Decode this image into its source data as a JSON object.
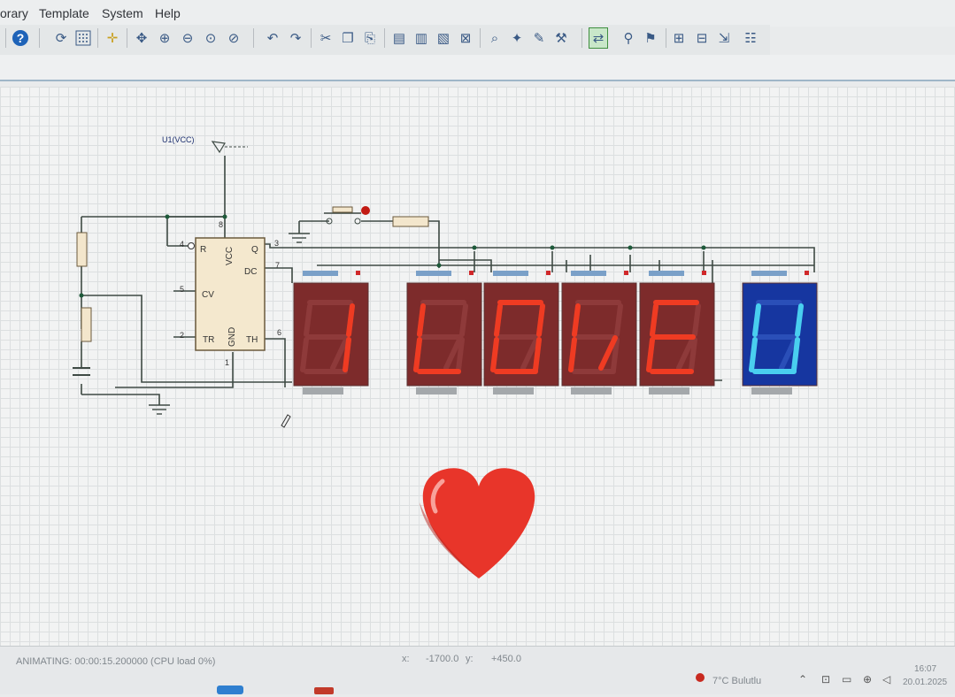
{
  "menu": [
    "orary",
    "Template",
    "System",
    "Help"
  ],
  "toolbar": {
    "icons": [
      "help-icon",
      "refresh-icon",
      "grid-toggle-icon",
      "origin-icon",
      "pan-icon",
      "zoom-in-icon",
      "zoom-out-icon",
      "zoom-all-icon",
      "zoom-area-icon",
      "undo-icon",
      "redo-icon",
      "cut-icon",
      "copy-icon",
      "paste-icon",
      "block-copy-icon",
      "block-move-icon",
      "block-rotate-icon",
      "block-delete-icon",
      "pick-device-icon",
      "make-device-icon",
      "packaging-tool-icon",
      "decompose-icon",
      "wire-autorouter-icon",
      "search-tag-icon",
      "property-assignment-icon",
      "new-sheet-icon",
      "remove-sheet-icon",
      "goto-sheet-icon",
      "bill-of-materials-icon"
    ]
  },
  "schematic": {
    "vcc_label": "U1(VCC)",
    "chip": {
      "pins_left": [
        {
          "num": "4",
          "name": "R"
        },
        {
          "num": "5",
          "name": "CV"
        },
        {
          "num": "2",
          "name": "TR"
        }
      ],
      "pins_right": [
        {
          "num": "3",
          "name": "Q"
        },
        {
          "num": "7",
          "name": "DC"
        },
        {
          "num": "6",
          "name": "TH"
        }
      ],
      "pin_top": {
        "num": "8",
        "name": "VCC"
      },
      "pin_bottom": {
        "num": "1",
        "name": "GND"
      }
    },
    "displays": [
      {
        "char": "I",
        "color": "red"
      },
      {
        "char": "L",
        "color": "red"
      },
      {
        "char": "O",
        "color": "red"
      },
      {
        "char": "V",
        "color": "red"
      },
      {
        "char": "E",
        "color": "red"
      },
      {
        "char": "U",
        "color": "blue"
      }
    ]
  },
  "status": {
    "animating": "ANIMATING: 00:00:15.200000 (CPU load 0%)",
    "x_label": "x:",
    "x_value": "-1700.0",
    "y_label": "y:",
    "y_value": "+450.0"
  },
  "taskbar": {
    "weather": "7°C  Bulutlu",
    "time": "16:07",
    "date": "20.01.2025"
  },
  "colors": {
    "red_display_body": "#7d2b2b",
    "red_segment_on": "#ef3b22",
    "blue_display_body": "#1636a0",
    "blue_segment_on": "#49cfef",
    "wire": "#3e4a44",
    "heart": "#e8352a"
  }
}
